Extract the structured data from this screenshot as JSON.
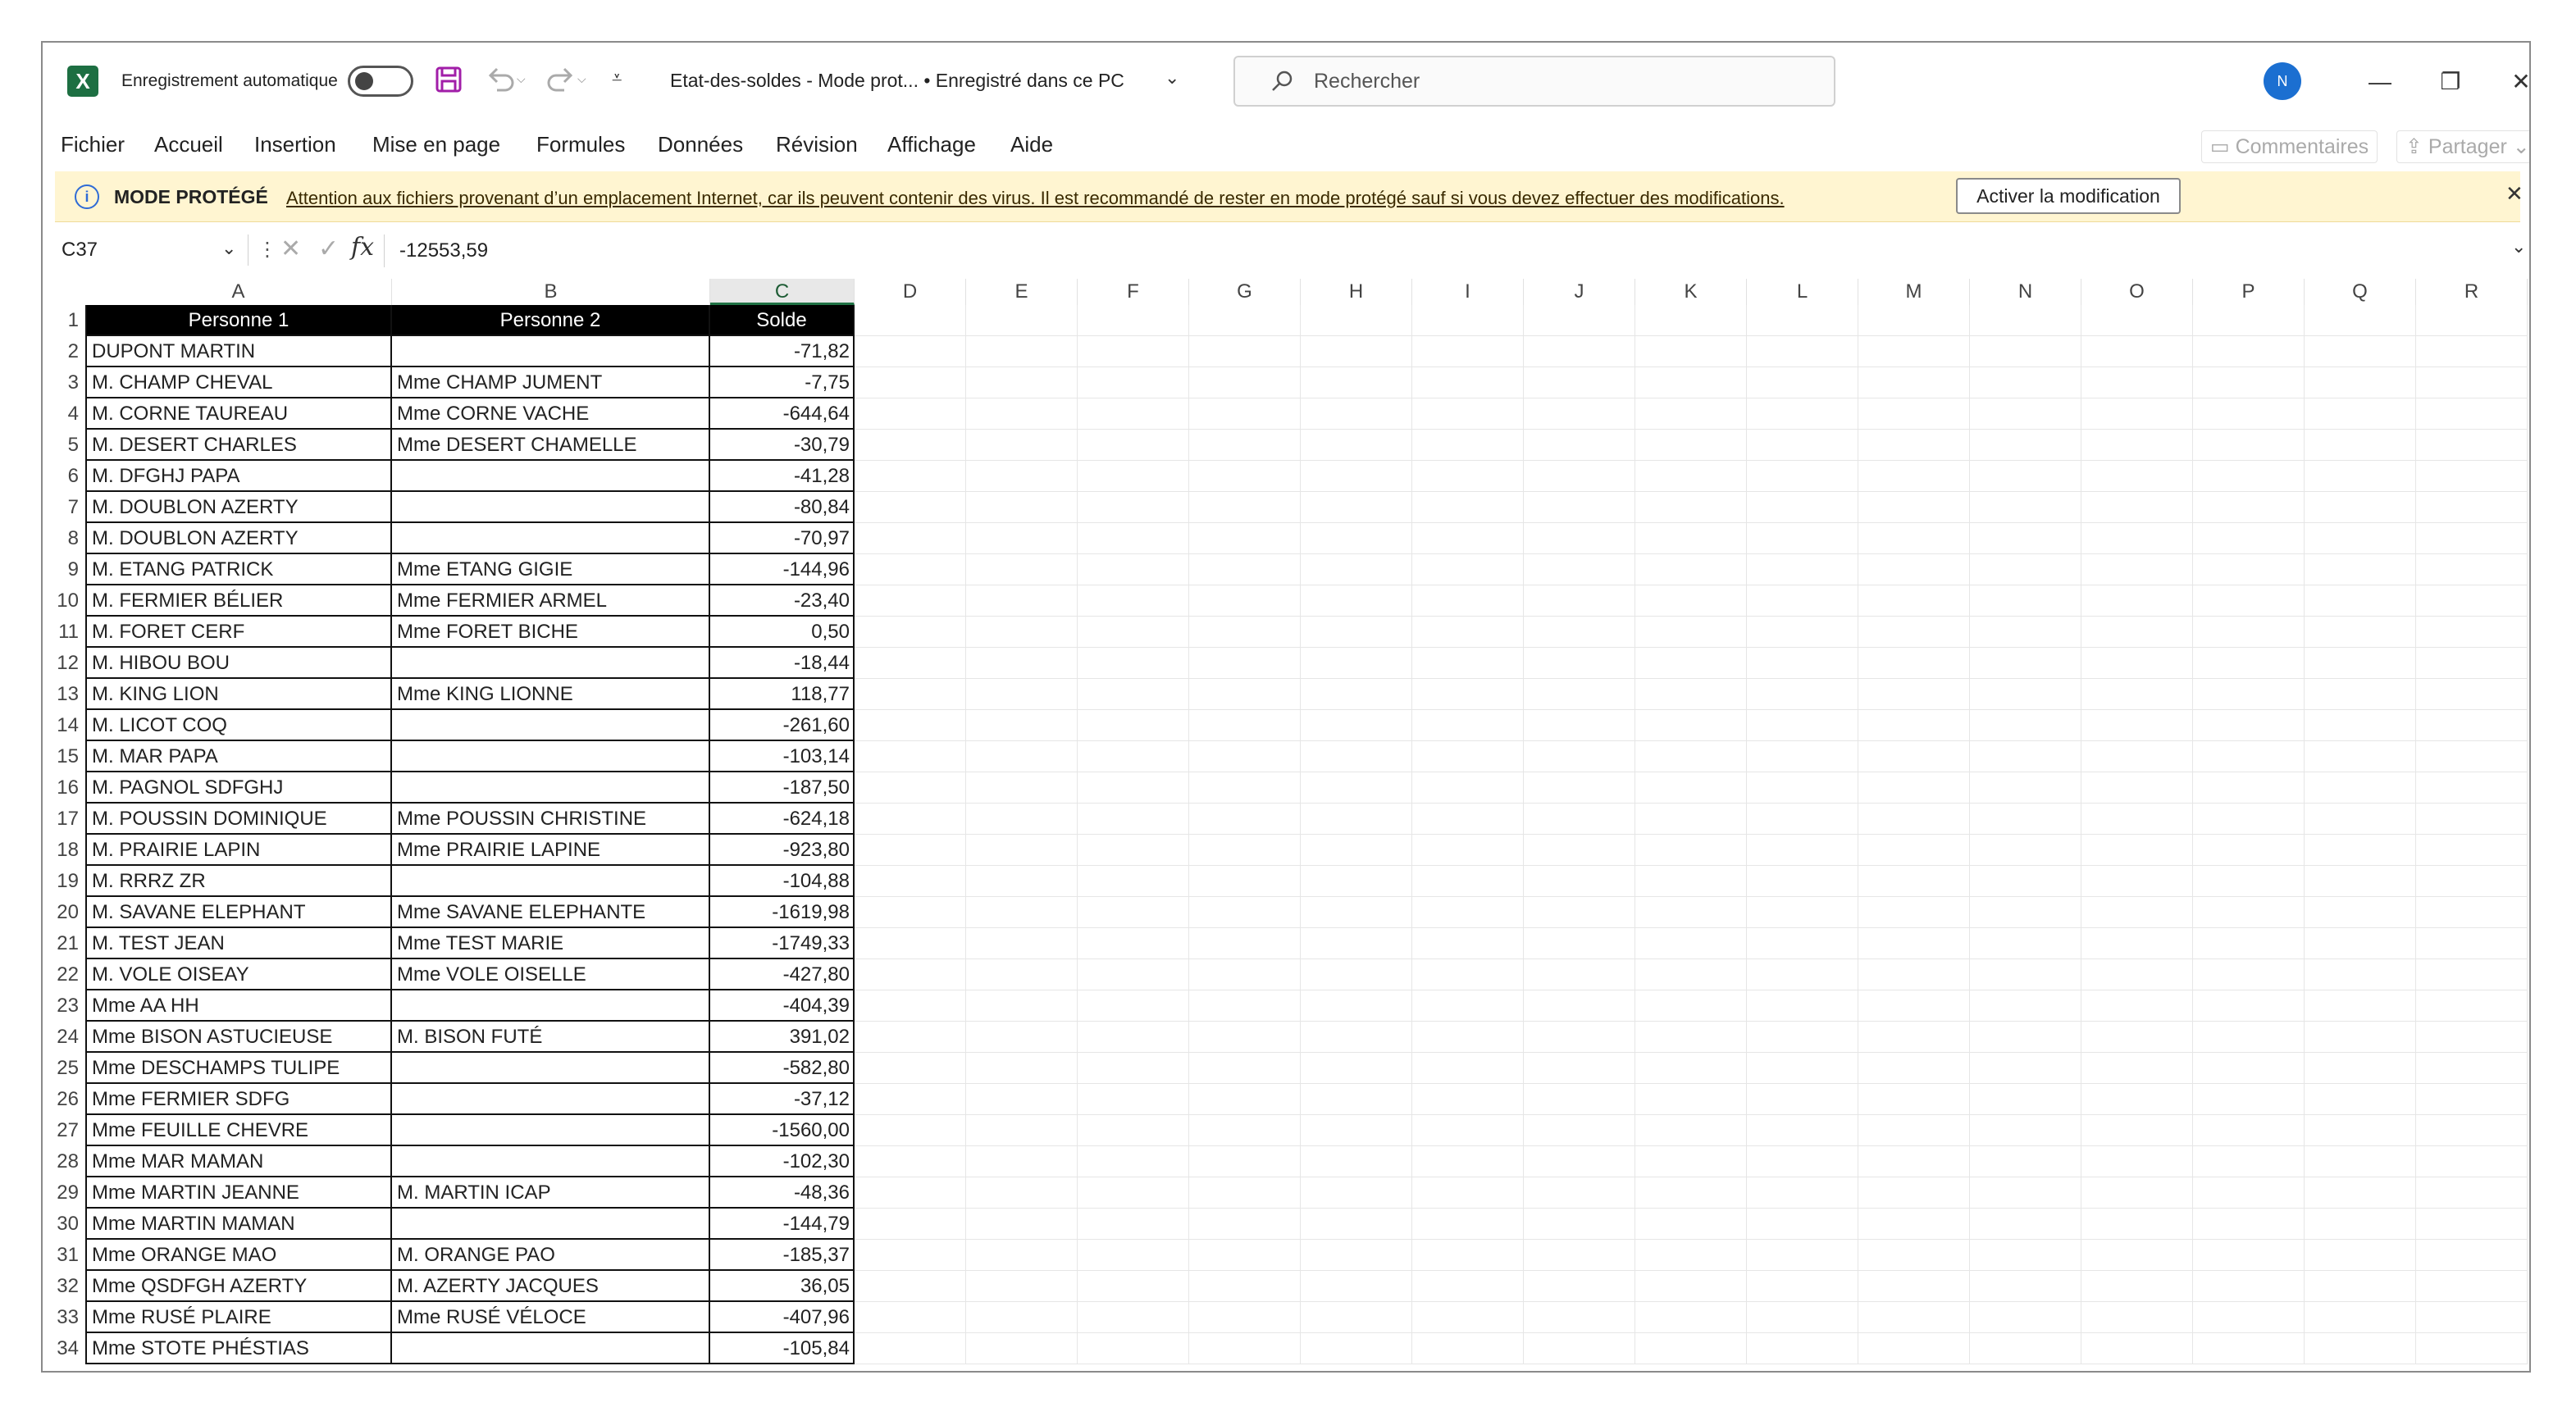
{
  "app": {
    "autosave_label": "Enregistrement automatique",
    "doc_title": "Etat-des-soldes  -  Mode prot...  •  Enregistré dans ce PC",
    "search_placeholder": "Rechercher",
    "avatar_initial": "N",
    "accent_color": "#217346"
  },
  "ribbon": {
    "tabs": [
      "Fichier",
      "Accueil",
      "Insertion",
      "Mise en page",
      "Formules",
      "Données",
      "Révision",
      "Affichage",
      "Aide"
    ],
    "comments_label": "Commentaires",
    "share_label": "Partager"
  },
  "banner": {
    "title": "MODE PROTÉGÉ",
    "message": "Attention aux fichiers provenant d’un emplacement Internet, car ils peuvent contenir des virus. Il est recommandé de rester en mode protégé sauf si vous devez effectuer des modifications.",
    "button": "Activer la modification"
  },
  "formula_bar": {
    "cell_ref": "C37",
    "value": "-12553,59"
  },
  "columns": [
    "A",
    "B",
    "C",
    "D",
    "E",
    "F",
    "G",
    "H",
    "I",
    "J",
    "K",
    "L",
    "M",
    "N",
    "O",
    "P",
    "Q",
    "R"
  ],
  "selected_column": "C",
  "table": {
    "headers": [
      "Personne 1",
      "Personne 2",
      "Solde"
    ],
    "rows": [
      [
        " DUPONT MARTIN",
        "",
        "-71,82"
      ],
      [
        "M. CHAMP CHEVAL",
        "Mme CHAMP JUMENT",
        "-7,75"
      ],
      [
        "M. CORNE TAUREAU",
        "Mme CORNE VACHE",
        "-644,64"
      ],
      [
        "M. DESERT CHARLES",
        "Mme DESERT CHAMELLE",
        "-30,79"
      ],
      [
        "M. DFGHJ PAPA",
        "",
        "-41,28"
      ],
      [
        "M. DOUBLON AZERTY",
        "",
        "-80,84"
      ],
      [
        "M. DOUBLON AZERTY",
        "",
        "-70,97"
      ],
      [
        "M. ETANG PATRICK",
        "Mme ETANG GIGIE",
        "-144,96"
      ],
      [
        "M. FERMIER BÉLIER",
        "Mme FERMIER ARMEL",
        "-23,40"
      ],
      [
        "M. FORET CERF",
        "Mme FORET BICHE",
        "0,50"
      ],
      [
        "M. HIBOU BOU",
        "",
        "-18,44"
      ],
      [
        "M. KING LION",
        "Mme KING LIONNE",
        "118,77"
      ],
      [
        "M. LICOT COQ",
        "",
        "-261,60"
      ],
      [
        "M. MAR PAPA",
        "",
        "-103,14"
      ],
      [
        "M. PAGNOL SDFGHJ",
        "",
        "-187,50"
      ],
      [
        "M. POUSSIN DOMINIQUE",
        "Mme POUSSIN CHRISTINE",
        "-624,18"
      ],
      [
        "M. PRAIRIE LAPIN",
        "Mme PRAIRIE LAPINE",
        "-923,80"
      ],
      [
        "M. RRRZ ZR",
        "",
        "-104,88"
      ],
      [
        "M. SAVANE ELEPHANT",
        "Mme SAVANE ELEPHANTE",
        "-1619,98"
      ],
      [
        "M. TEST JEAN",
        "Mme TEST MARIE",
        "-1749,33"
      ],
      [
        "M. VOLE OISEAY",
        "Mme VOLE OISELLE",
        "-427,80"
      ],
      [
        "Mme AA HH",
        "",
        "-404,39"
      ],
      [
        "Mme BISON ASTUCIEUSE",
        "M. BISON FUTÉ",
        "391,02"
      ],
      [
        "Mme DESCHAMPS TULIPE",
        "",
        "-582,80"
      ],
      [
        "Mme FERMIER SDFG",
        "",
        "-37,12"
      ],
      [
        "Mme FEUILLE CHEVRE",
        "",
        "-1560,00"
      ],
      [
        "Mme MAR MAMAN",
        "",
        "-102,30"
      ],
      [
        "Mme MARTIN JEANNE",
        "M. MARTIN ICAP",
        "-48,36"
      ],
      [
        "Mme MARTIN MAMAN",
        "",
        "-144,79"
      ],
      [
        "Mme ORANGE MAO",
        "M. ORANGE PAO",
        "-185,37"
      ],
      [
        "Mme QSDFGH AZERTY",
        "M. AZERTY JACQUES",
        "36,05"
      ],
      [
        "Mme RUSÉ PLAIRE",
        "Mme RUSÉ VÉLOCE",
        "-407,96"
      ],
      [
        "Mme STOTE PHÉSTIAS",
        "",
        "-105,84"
      ]
    ]
  }
}
